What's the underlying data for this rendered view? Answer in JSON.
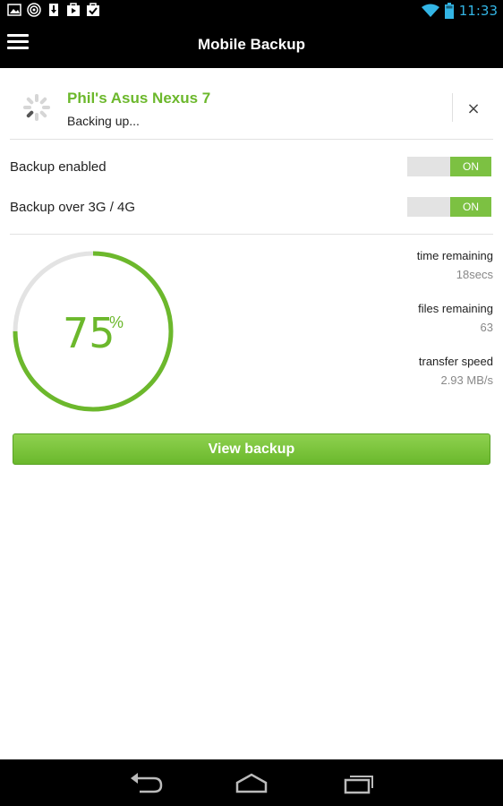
{
  "status_bar": {
    "time": "11:33",
    "left_icons": [
      "gallery-icon",
      "radar-icon",
      "download-icon",
      "play-store-icon",
      "task-check-icon"
    ],
    "right_icons": [
      "wifi-icon",
      "battery-icon"
    ],
    "accent_color": "#33b5e5"
  },
  "app_bar": {
    "title": "Mobile Backup",
    "menu_icon": "hamburger-menu-icon"
  },
  "device": {
    "name": "Phil's Asus Nexus 7",
    "status": "Backing up...",
    "close_label": "×",
    "spinner_icon": "loading-spinner-icon"
  },
  "settings": [
    {
      "label": "Backup enabled",
      "toggle_state": "ON"
    },
    {
      "label": "Backup over 3G / 4G",
      "toggle_state": "ON"
    }
  ],
  "progress": {
    "percent": 75,
    "value_text": "75",
    "unit": "%"
  },
  "stats": [
    {
      "label": "time remaining",
      "value": "18secs"
    },
    {
      "label": "files remaining",
      "value": "63"
    },
    {
      "label": "transfer speed",
      "value": "2.93 MB/s"
    }
  ],
  "actions": {
    "view_backup": "View backup"
  },
  "nav_bar": {
    "icons": [
      "back-icon",
      "home-icon",
      "recent-apps-icon"
    ]
  },
  "colors": {
    "brand_green": "#6cb82c",
    "toggle_green": "#7cc142",
    "track_gray": "#e3e3e3"
  }
}
